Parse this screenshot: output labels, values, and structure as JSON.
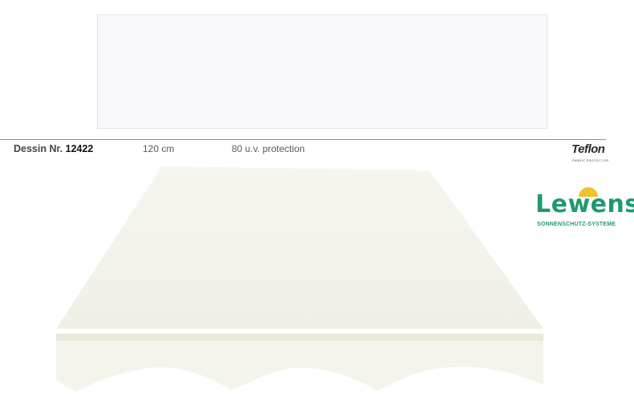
{
  "product": {
    "dessin_label": "Dessin Nr.",
    "dessin_number": "12422",
    "width": "120 cm",
    "uv": "80 u.v. protection"
  },
  "badges": {
    "teflon_word": "Teflon",
    "teflon_sub": "FABRIC PROTECTOR"
  },
  "brand": {
    "name": "Lewens",
    "tagline": "SONNENSCHUTZ-SYSTEME",
    "color": "#1f9a6e",
    "sun_color": "#f2c12e"
  },
  "colors": {
    "fabric": "#ecebf1",
    "awning": "#f3f2ea",
    "awning_stripe": "#e9e6d6"
  },
  "icons": [
    "sun-icon"
  ]
}
